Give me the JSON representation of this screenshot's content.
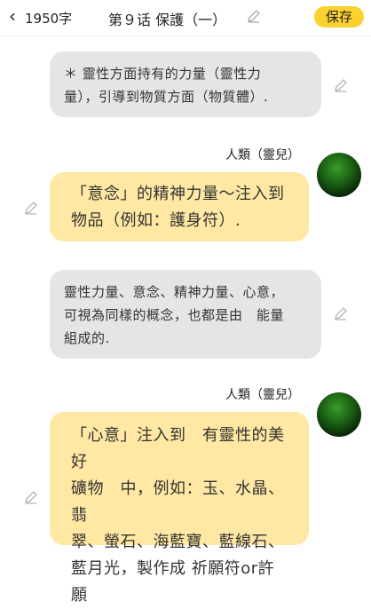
{
  "header": {
    "back_icon": "chevron-left-icon",
    "count": "1950字",
    "title": "第９话 保護（一）",
    "edit_icon": "pencil-icon",
    "save_label": "保存"
  },
  "messages": [
    {
      "type": "narration",
      "lines": [
        "＊ 靈性方面持有的力量（靈性力",
        "量），引導到物質方面（物質體）."
      ]
    },
    {
      "type": "speech",
      "speaker": "人類（靈兒）",
      "lines": [
        "「意念」的精神力量～注入到",
        "物品（例如：護身符）."
      ]
    },
    {
      "type": "narration",
      "lines": [
        "靈性力量、意念、精神力量、心意，",
        "可視為同樣的概念，也都是由　能量",
        "組成的."
      ]
    },
    {
      "type": "speech",
      "speaker": "人類（靈兒）",
      "lines": [
        "「心意」注入到　有靈性的美好",
        "礦物　中，例如：玉、水晶、翡",
        "翠、螢石、海藍寶、藍線石、",
        "藍月光，製作成 祈願符or許願"
      ]
    }
  ],
  "colors": {
    "save_button": "#f9d230",
    "narration_bubble": "#e5e5e5",
    "speech_bubble": "#ffe8a3",
    "avatar": "#2a7a1e"
  }
}
